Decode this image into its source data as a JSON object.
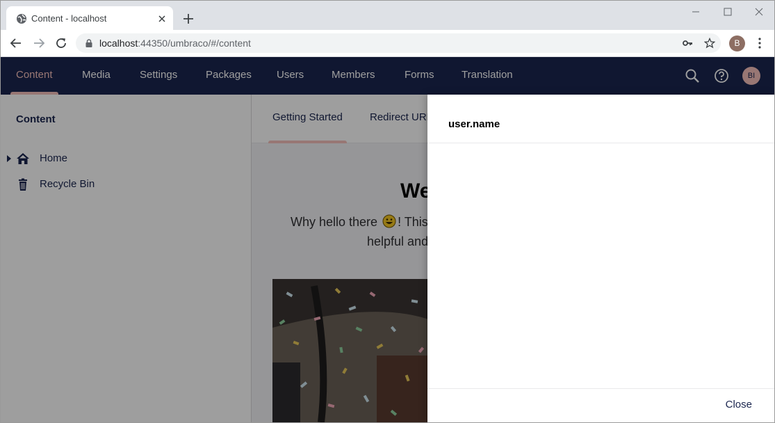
{
  "browser": {
    "tab_title": "Content - localhost",
    "url_host": "localhost",
    "url_rest": ":44350/umbraco/#/content",
    "profile_initial": "B"
  },
  "header": {
    "sections": [
      {
        "label": "Content",
        "active": true
      },
      {
        "label": "Media"
      },
      {
        "label": "Settings"
      },
      {
        "label": "Packages"
      },
      {
        "label": "Users"
      },
      {
        "label": "Members"
      },
      {
        "label": "Forms"
      },
      {
        "label": "Translation"
      }
    ],
    "avatar_initials": "BI",
    "accent_color": "#f5c1bc",
    "bar_color": "#1b264f"
  },
  "tree": {
    "title": "Content",
    "items": [
      {
        "label": "Home",
        "icon": "home-icon"
      },
      {
        "label": "Recycle Bin",
        "icon": "trash-icon"
      }
    ]
  },
  "dashboard": {
    "tabs": [
      {
        "label": "Getting Started"
      },
      {
        "label": "Redirect URL"
      }
    ],
    "welcome_partial": "We",
    "intro_line1_a": "Why hello there",
    "intro_line1_b": "! This",
    "intro_line2": "helpful and"
  },
  "dialog": {
    "title": "user.name",
    "close_label": "Close"
  }
}
